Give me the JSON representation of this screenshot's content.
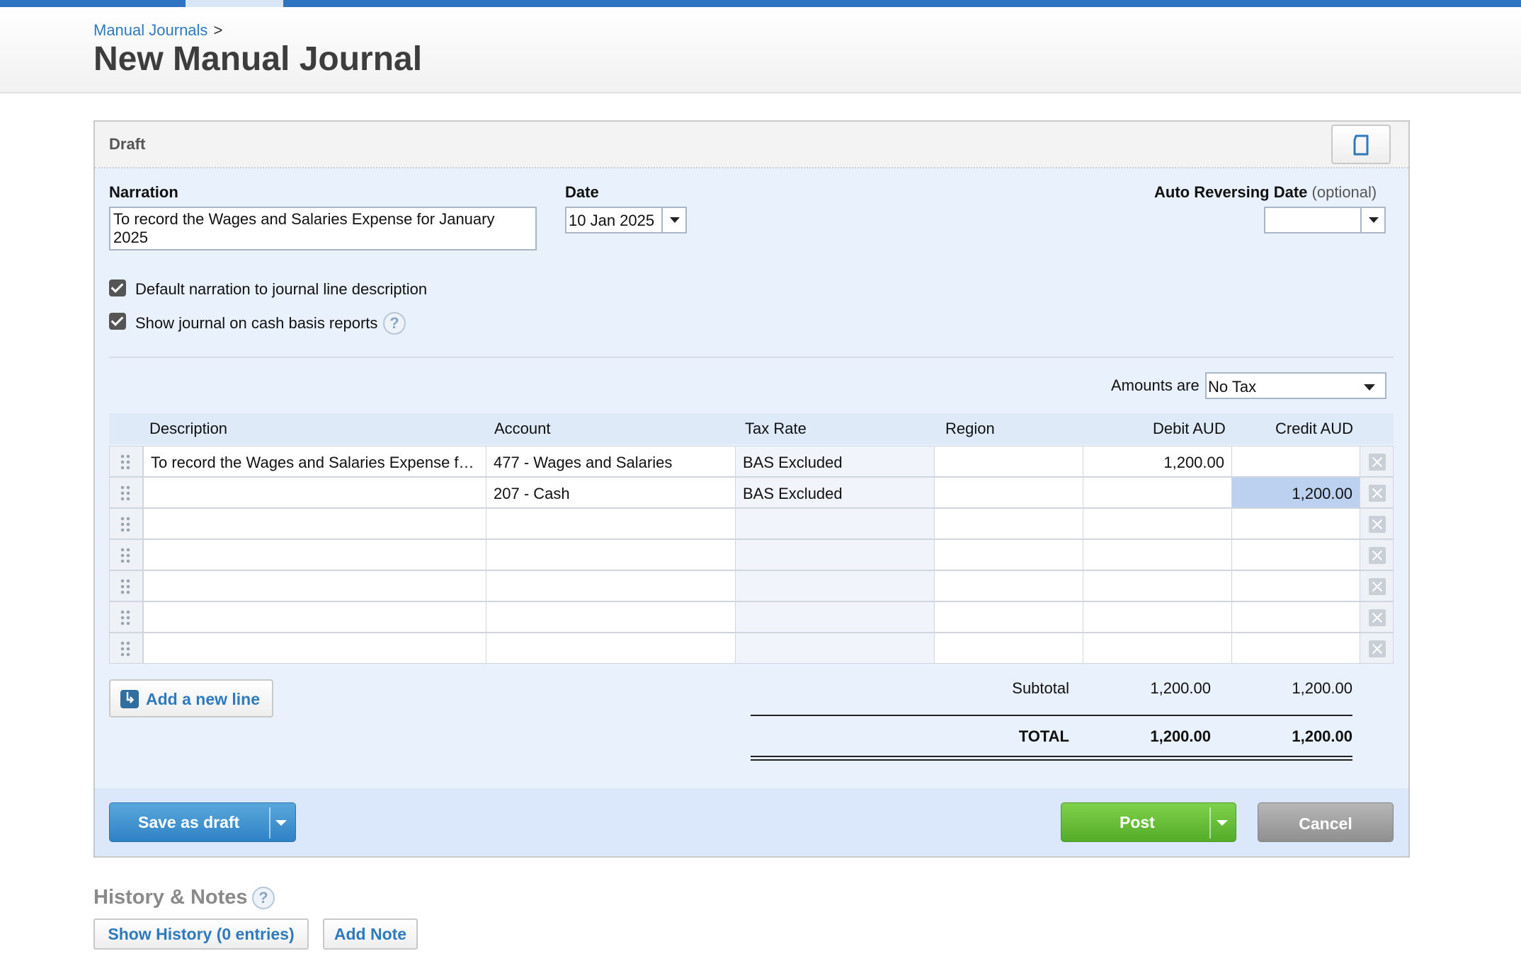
{
  "breadcrumb": {
    "parent": "Manual Journals",
    "separator": ">"
  },
  "page_title": "New Manual Journal",
  "status": "Draft",
  "form": {
    "narration_label": "Narration",
    "narration_value": "To record the Wages and Salaries Expense for January 2025",
    "date_label": "Date",
    "date_value": "10 Jan 2025",
    "auto_reversing_label": "Auto Reversing Date",
    "auto_reversing_optional": "(optional)",
    "auto_reversing_value": "",
    "default_narration_label": "Default narration to journal line description",
    "default_narration_checked": true,
    "cash_basis_label": "Show journal on cash basis reports",
    "cash_basis_checked": true,
    "help_glyph": "?"
  },
  "amounts": {
    "label": "Amounts are",
    "selected": "No Tax"
  },
  "table": {
    "headers": [
      "Description",
      "Account",
      "Tax Rate",
      "Region",
      "Debit AUD",
      "Credit AUD"
    ],
    "rows": [
      {
        "description": "To record the Wages and Salaries Expense f…",
        "account": "477 - Wages and Salaries",
        "tax_rate": "BAS Excluded",
        "region": "",
        "debit": "1,200.00",
        "credit": ""
      },
      {
        "description": "",
        "account": "207 - Cash",
        "tax_rate": "BAS Excluded",
        "region": "",
        "debit": "",
        "credit": "1,200.00"
      },
      {
        "description": "",
        "account": "",
        "tax_rate": "",
        "region": "",
        "debit": "",
        "credit": ""
      },
      {
        "description": "",
        "account": "",
        "tax_rate": "",
        "region": "",
        "debit": "",
        "credit": ""
      },
      {
        "description": "",
        "account": "",
        "tax_rate": "",
        "region": "",
        "debit": "",
        "credit": ""
      },
      {
        "description": "",
        "account": "",
        "tax_rate": "",
        "region": "",
        "debit": "",
        "credit": ""
      },
      {
        "description": "",
        "account": "",
        "tax_rate": "",
        "region": "",
        "debit": "",
        "credit": ""
      }
    ]
  },
  "add_line_label": "Add a new line",
  "totals": {
    "subtotal_label": "Subtotal",
    "subtotal_debit": "1,200.00",
    "subtotal_credit": "1,200.00",
    "total_label": "TOTAL",
    "total_debit": "1,200.00",
    "total_credit": "1,200.00"
  },
  "actions": {
    "save_draft": "Save as draft",
    "post": "Post",
    "cancel": "Cancel"
  },
  "history": {
    "title": "History & Notes",
    "show_history": "Show History (0 entries)",
    "add_note": "Add Note"
  },
  "colors": {
    "accent_blue": "#2f74c0",
    "post_green": "#5cb531",
    "panel_bg": "#e9f1fc",
    "cancel_grey": "#9a9a9a"
  },
  "icons": {
    "header_button": "document-icon",
    "help": "help-icon",
    "row_handle": "drag-handle-icon",
    "row_delete": "delete-row-icon",
    "add_line": "add-line-icon"
  }
}
